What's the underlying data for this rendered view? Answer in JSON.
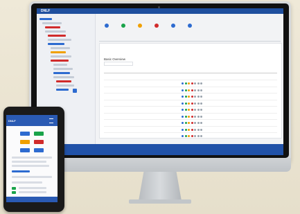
{
  "desktop": {
    "logo": "DNLF",
    "nav_items": [
      "",
      "",
      "",
      "",
      ""
    ],
    "nav_right": [
      "",
      ""
    ],
    "page_title": "",
    "toolbar": [
      {
        "label": "",
        "color": "#2d6bd0"
      },
      {
        "label": "",
        "color": "#1aa34a"
      },
      {
        "label": "",
        "color": "#f0a000"
      },
      {
        "label": "",
        "color": "#d12b2b"
      },
      {
        "label": "",
        "color": "#2d6bd0"
      },
      {
        "label": "",
        "color": "#2d6bd0"
      }
    ],
    "tabs": [
      "",
      "",
      "",
      "",
      ""
    ],
    "card_title": "Basic Overview",
    "table_header": [
      "",
      ""
    ],
    "rows": [
      {
        "name": ""
      },
      {
        "name": ""
      },
      {
        "name": ""
      },
      {
        "name": ""
      },
      {
        "name": ""
      },
      {
        "name": ""
      },
      {
        "name": ""
      },
      {
        "name": ""
      },
      {
        "name": ""
      }
    ],
    "row_icon_colors": [
      "#2d6bd0",
      "#1aa34a",
      "#f0a000",
      "#d12b2b",
      "#9aa3ad",
      "#9aa3ad",
      "#9aa3ad"
    ],
    "footer_text": ""
  },
  "phone": {
    "logo": "DNLF",
    "bottom_text": ""
  },
  "colors": {
    "brand_blue": "#1f4f9e",
    "footer_blue": "#2152a8",
    "background": "#ece6d4"
  }
}
